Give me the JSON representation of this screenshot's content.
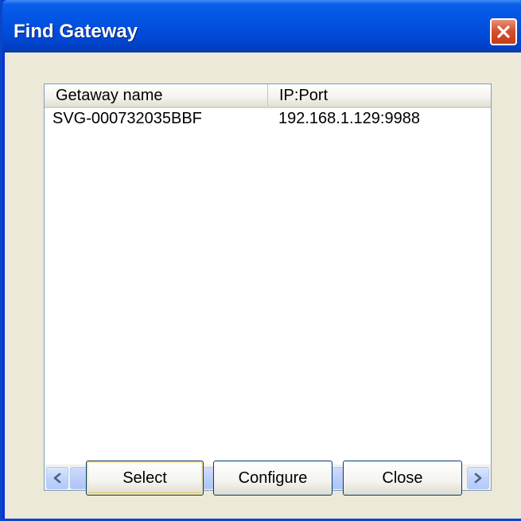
{
  "window": {
    "title": "Find Gateway",
    "close_icon": "close-x-icon"
  },
  "list": {
    "columns": [
      "Getaway name",
      "IP:Port"
    ],
    "rows": [
      {
        "name": "SVG-000732035BBF",
        "ip_port": "192.168.1.129:9988"
      }
    ],
    "scrollbar": {
      "left_icon": "arrow-left-icon",
      "right_icon": "arrow-right-icon",
      "thumb_icon": "scroll-grip-icon"
    }
  },
  "buttons": {
    "select": "Select",
    "configure": "Configure",
    "close": "Close"
  },
  "colors": {
    "titlebar": "#0356e5",
    "dialog_bg": "#ece9d8",
    "close_button": "#d4512f",
    "scrollbar": "#c1d4fb"
  }
}
